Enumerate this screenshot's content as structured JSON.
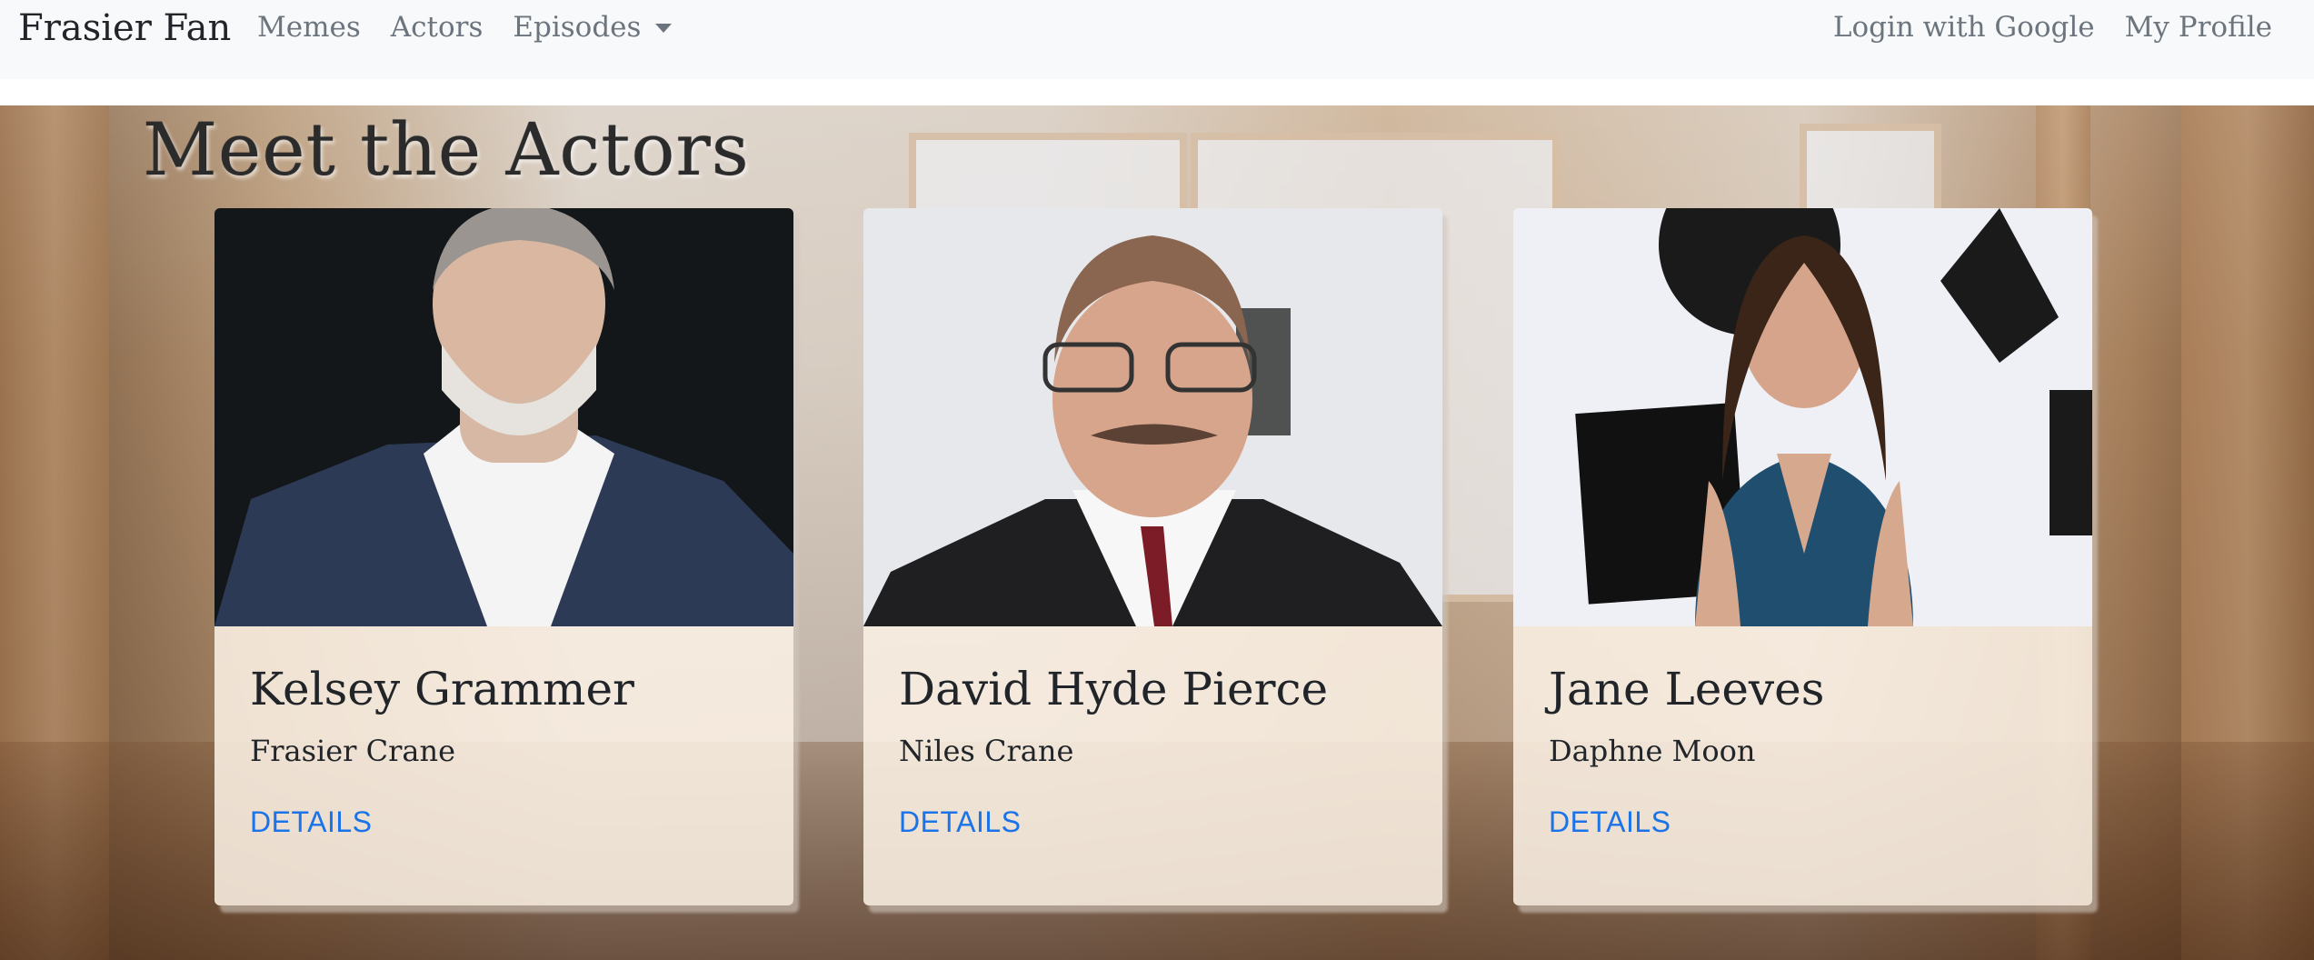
{
  "navbar": {
    "brand": "Frasier Fan",
    "links": [
      "Memes",
      "Actors",
      "Episodes"
    ],
    "right_links": [
      "Login with Google",
      "My Profile"
    ]
  },
  "page": {
    "title": "Meet the Actors"
  },
  "actors": [
    {
      "name": "Kelsey Grammer",
      "role": "Frasier Crane",
      "link": "DETAILS"
    },
    {
      "name": "David Hyde Pierce",
      "role": "Niles Crane",
      "link": "DETAILS"
    },
    {
      "name": "Jane Leeves",
      "role": "Daphne Moon",
      "link": "DETAILS"
    }
  ],
  "colors": {
    "navbar_bg": "#f8f9fa",
    "link_blue": "#1a73e8",
    "card_body_bg": "#faf0e4"
  }
}
